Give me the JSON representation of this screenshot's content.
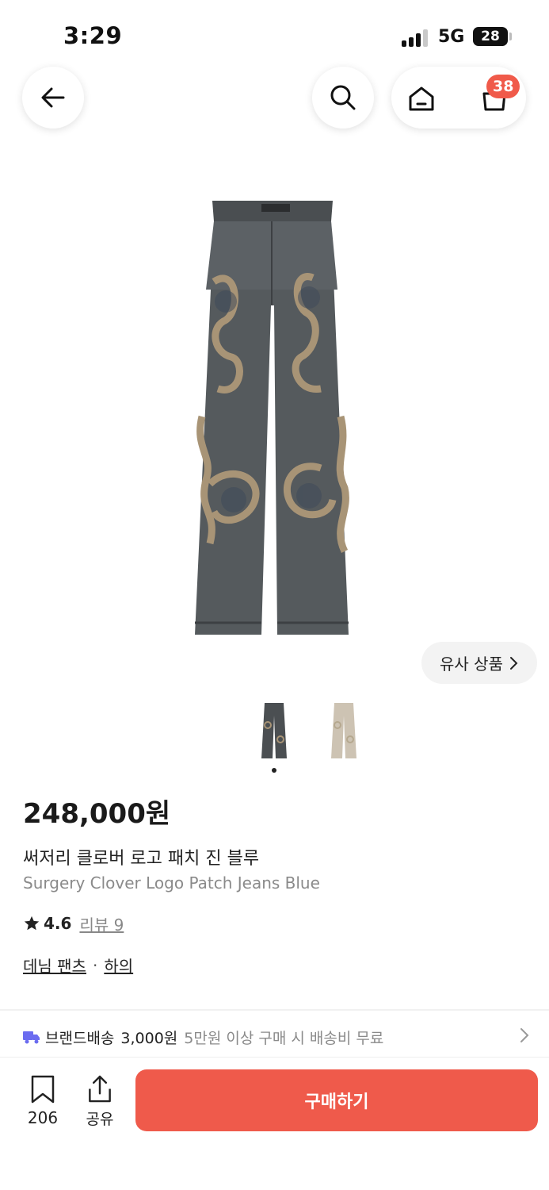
{
  "status_bar": {
    "time": "3:29",
    "network": "5G",
    "battery": "28"
  },
  "nav": {
    "cart_count": "38"
  },
  "product": {
    "similar_label": "유사 상품",
    "price": "248,000원",
    "name_ko": "써저리 클로버 로고 패치 진 블루",
    "name_en": "Surgery Clover Logo Patch Jeans Blue",
    "rating": "4.6",
    "review_label": "리뷰 9",
    "categories": [
      "데님 팬츠",
      "하의"
    ],
    "category_separator": "·",
    "image_count": 2,
    "current_image": 1
  },
  "shipping": {
    "label": "브랜드배송",
    "fee": "3,000원",
    "note": "5만원 이상 구매 시 배송비 무료"
  },
  "bottom_bar": {
    "save_count": "206",
    "share_label": "공유",
    "buy_label": "구매하기"
  },
  "colors": {
    "accent": "#ef5a4b",
    "badge": "#f05a4a",
    "shipping_icon": "#6b6cf0",
    "denim_dark": "#4b4f52",
    "patch_tan": "#a89476"
  }
}
